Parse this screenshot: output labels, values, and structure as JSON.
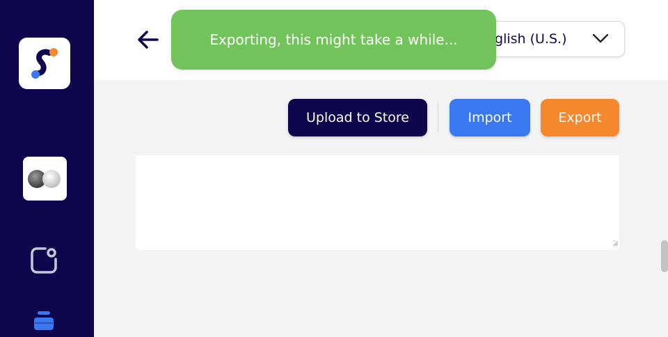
{
  "sidebar": {
    "logo_icon": "brand-s-logo",
    "items": [
      {
        "icon": "app-toggle-icon"
      },
      {
        "icon": "notification-square-icon"
      },
      {
        "icon": "stack-layers-icon"
      }
    ],
    "colors": {
      "background": "#10064d",
      "accent": "#3a78f2"
    }
  },
  "header": {
    "back_icon": "arrow-left-icon",
    "language": {
      "value": "English (U.S.)",
      "visible_text": "nglish (U.S.)",
      "icon": "chevron-down-icon"
    }
  },
  "toast": {
    "message": "Exporting, this might take a while...",
    "color": "#72c35c"
  },
  "toolbar": {
    "upload_label": "Upload to Store",
    "import_label": "Import",
    "export_label": "Export",
    "colors": {
      "upload": "#10064d",
      "import": "#3a78f2",
      "export": "#f5872d"
    }
  }
}
